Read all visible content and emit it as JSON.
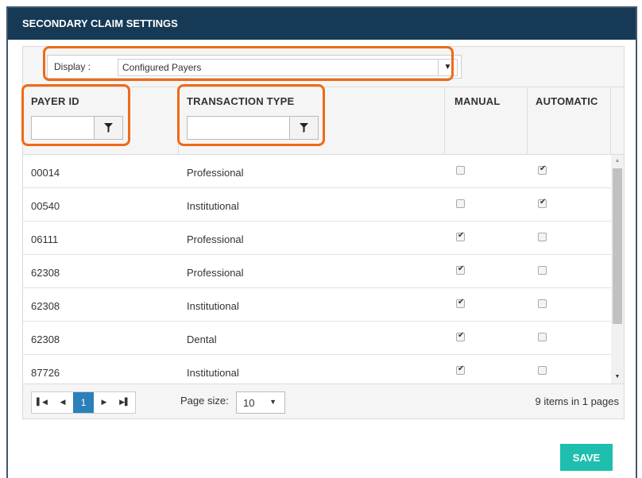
{
  "panel": {
    "title": "SECONDARY CLAIM SETTINGS"
  },
  "display": {
    "label": "Display :",
    "selected": "Configured Payers"
  },
  "columns": {
    "payer_id": "PAYER ID",
    "transaction_type": "TRANSACTION TYPE",
    "manual": "MANUAL",
    "automatic": "AUTOMATIC"
  },
  "filters": {
    "payer_id_value": "",
    "transaction_type_value": ""
  },
  "rows": [
    {
      "payer_id": "00014",
      "type": "Professional",
      "manual": false,
      "automatic": true
    },
    {
      "payer_id": "00540",
      "type": "Institutional",
      "manual": false,
      "automatic": true
    },
    {
      "payer_id": "06111",
      "type": "Professional",
      "manual": true,
      "automatic": false
    },
    {
      "payer_id": "62308",
      "type": "Professional",
      "manual": true,
      "automatic": false
    },
    {
      "payer_id": "62308",
      "type": "Institutional",
      "manual": true,
      "automatic": false
    },
    {
      "payer_id": "62308",
      "type": "Dental",
      "manual": true,
      "automatic": false
    },
    {
      "payer_id": "87726",
      "type": "Institutional",
      "manual": true,
      "automatic": false
    }
  ],
  "pager": {
    "current_page": "1",
    "page_size_label": "Page size:",
    "page_size": "10",
    "info": "9 items in 1 pages"
  },
  "actions": {
    "save": "SAVE"
  },
  "colors": {
    "header_bg": "#163a56",
    "highlight": "#ee6a18",
    "accent": "#1ebfae",
    "active_page": "#2b80b9"
  },
  "icons": [
    "funnel-filter-icon",
    "dropdown-arrow-icon",
    "first-page-icon",
    "prev-page-icon",
    "next-page-icon",
    "last-page-icon",
    "scroll-up-icon",
    "scroll-down-icon",
    "checkmark-icon"
  ]
}
